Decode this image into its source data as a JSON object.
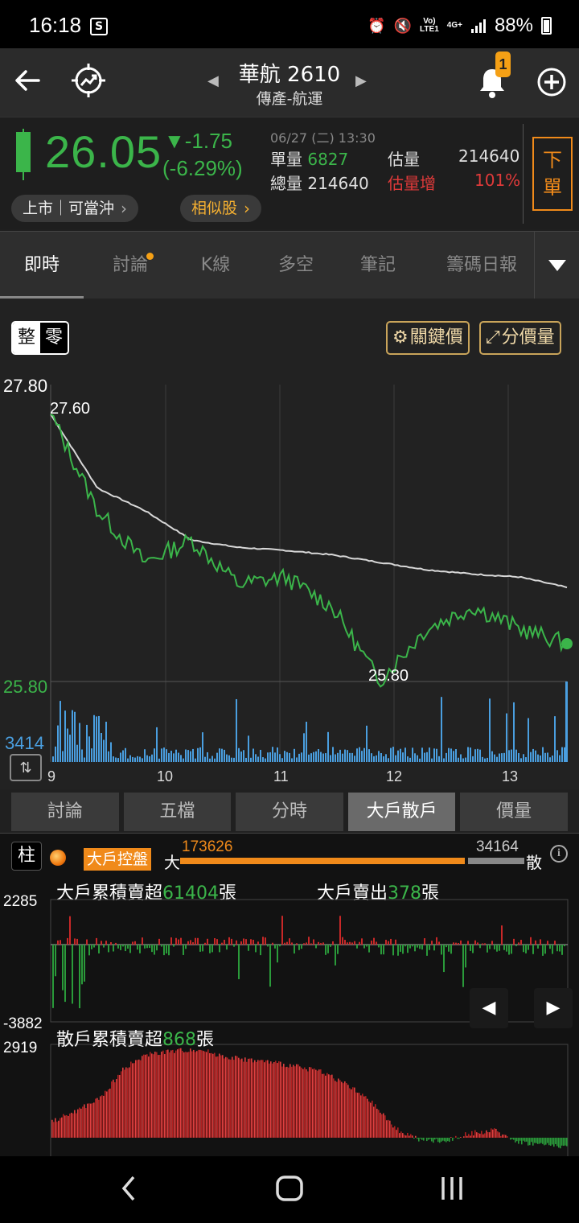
{
  "status": {
    "time": "16:18",
    "battery": "88%",
    "net1": "Vo)",
    "net1b": "LTE1",
    "net2": "4G+"
  },
  "header": {
    "title": "華航 2610",
    "subtitle": "傳產-航運",
    "badge": "1"
  },
  "quote": {
    "price": "26.05",
    "change": "▼-1.75",
    "change_pct": "(-6.29%)",
    "datetime": "06/27 (二) 13:30",
    "single_vol_label": "單量",
    "single_vol": "6827",
    "total_vol_label": "總量",
    "total_vol": "214640",
    "est_vol_label": "估量",
    "est_vol": "214640",
    "est_inc_label": "估量增",
    "est_inc": "101%",
    "order_label_1": "下",
    "order_label_2": "單",
    "market_chip": "上市｜可當沖",
    "similar_chip": "相似股"
  },
  "tabs": [
    "即時",
    "討論",
    "K線",
    "多空",
    "筆記",
    "籌碼日報"
  ],
  "chart": {
    "lot_whole": "整",
    "lot_odd": "零",
    "key_price_btn": "關鍵價",
    "price_vol_btn": "分價量",
    "y_max": "27.80",
    "y_min": "25.80",
    "vol_max": "3414",
    "high_label": "27.60",
    "low_label": "25.80",
    "times": [
      "9",
      "10",
      "11",
      "12",
      "13"
    ]
  },
  "chart_data": {
    "type": "line",
    "title": "",
    "ylim": [
      25.8,
      27.8
    ],
    "x": [
      "9:00",
      "9:15",
      "9:30",
      "10:00",
      "10:30",
      "11:00",
      "11:30",
      "11:55",
      "12:00",
      "12:30",
      "13:00",
      "13:30"
    ],
    "series": [
      {
        "values": [
          27.6,
          26.95,
          26.6,
          26.75,
          26.45,
          26.5,
          26.3,
          25.8,
          26.15,
          26.3,
          26.15,
          26.05
        ]
      },
      {
        "values": [
          27.6,
          27.1,
          26.95,
          26.75,
          26.7,
          26.68,
          26.65,
          26.6,
          26.55,
          26.52,
          26.5,
          26.43
        ]
      }
    ],
    "volume_max": 3414
  },
  "subtabs": [
    "討論",
    "五檔",
    "分時",
    "大戶散戶",
    "價量"
  ],
  "panel": {
    "pillar": "柱",
    "control_badge": "大戶控盤",
    "big_label": "大",
    "small_label": "散",
    "big_value": "173626",
    "small_value": "34164",
    "big_ratio": 0.8356,
    "big_net_label": "大戶累積賣超",
    "big_net_value": "61404",
    "big_net_unit": "張",
    "big_sell_label": "大戶賣出",
    "big_sell_value": "378",
    "big_sell_unit": "張",
    "big_axis_max": "2285",
    "big_axis_min": "-3882",
    "retail_label": "散戶累積賣超",
    "retail_value": "868",
    "retail_unit": "張",
    "retail_axis_max": "2919"
  }
}
